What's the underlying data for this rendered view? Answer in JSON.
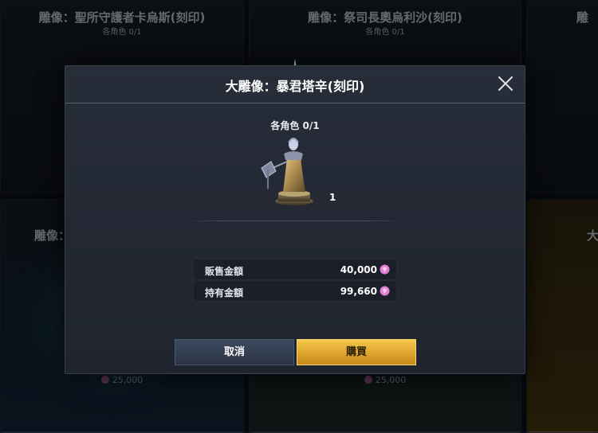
{
  "background": {
    "cards": [
      {
        "title": "雕像：聖所守護者卡烏斯(刻印)",
        "sub": "各角色  0/1"
      },
      {
        "title": "雕像：祭司長奧烏利沙(刻印)",
        "sub": "各角色  0/1"
      },
      {
        "title": "雕",
        "sub": ""
      },
      {
        "title": "雕像：",
        "sub": ""
      },
      {
        "title": "",
        "sub": ""
      },
      {
        "title": "大",
        "sub": ""
      }
    ],
    "prices": [
      "25,000",
      "25,000"
    ]
  },
  "dialog": {
    "title": "大雕像：暴君塔辛(刻印)",
    "subtitle": "各角色  0/1",
    "statue_count": "1",
    "rows": [
      {
        "label": "販售金額",
        "value": "40,000"
      },
      {
        "label": "持有金額",
        "value": "99,660"
      }
    ],
    "cancel_label": "取消",
    "buy_label": "購買"
  },
  "colors": {
    "accent_gold": "#e2ad33",
    "cancel_blue": "#34405a",
    "gem_pink": "#e07fd3"
  },
  "icons": [
    "close-icon",
    "sparkle-icon",
    "gem-icon",
    "statue-image"
  ]
}
